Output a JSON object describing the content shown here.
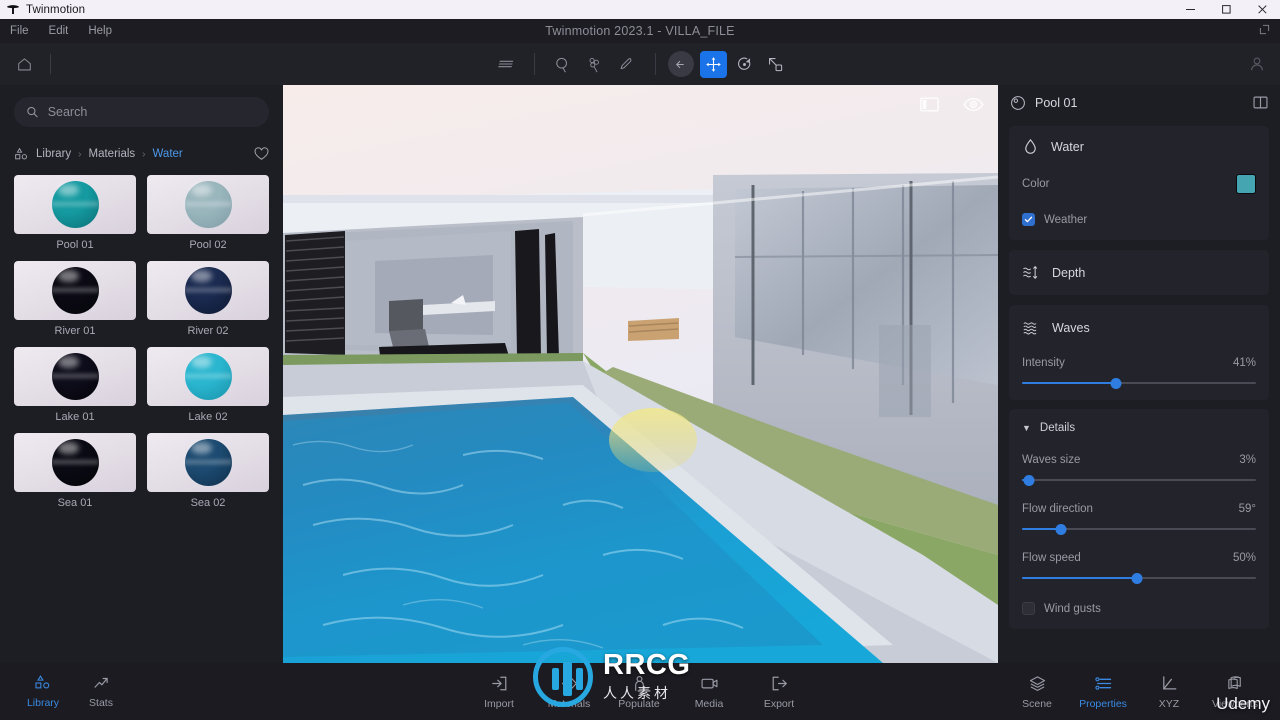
{
  "window": {
    "app_name": "Twinmotion",
    "document_title": "Twinmotion 2023.1 - VILLA_FILE",
    "controls": {
      "minimize": "–",
      "maximize": "❐",
      "close": "✕"
    }
  },
  "menu": {
    "items": [
      {
        "label": "File",
        "name": "menu-file"
      },
      {
        "label": "Edit",
        "name": "menu-edit"
      },
      {
        "label": "Help",
        "name": "menu-help"
      }
    ]
  },
  "toolbar": {
    "home_icon": "home-icon",
    "layers_icon": "layers-stack-icon",
    "tools": [
      {
        "name": "select-object-icon",
        "label": "Select object"
      },
      {
        "name": "select-material-icon",
        "label": "Select material"
      },
      {
        "name": "eyedropper-icon",
        "label": "Pick material"
      }
    ],
    "gizmos": [
      {
        "name": "undo-back-icon",
        "label": "Back",
        "active": false
      },
      {
        "name": "move-gizmo-icon",
        "label": "Move",
        "active": true
      },
      {
        "name": "rotate-gizmo-icon",
        "label": "Rotate",
        "active": false
      },
      {
        "name": "scale-gizmo-icon",
        "label": "Scale",
        "active": false
      }
    ],
    "account_icon": "user-account-icon",
    "active_accent": "#1a73e8"
  },
  "library": {
    "search": {
      "placeholder": "Search",
      "value": "",
      "icon": "search-icon"
    },
    "breadcrumb": {
      "root_icon": "library-shapes-icon",
      "items": [
        "Library",
        "Materials",
        "Water"
      ],
      "separator": "›",
      "favorite_icon": "heart-icon"
    },
    "materials": [
      {
        "label": "Pool 01",
        "color": "#149aa0",
        "shade": "#0b6f76",
        "selected": true
      },
      {
        "label": "Pool 02",
        "color": "#9ab6bd",
        "shade": "#7f9ba4",
        "selected": false
      },
      {
        "label": "River 01",
        "color": "#0b0a14",
        "shade": "#05050a",
        "selected": false
      },
      {
        "label": "River 02",
        "color": "#1a2a50",
        "shade": "#0d1830",
        "selected": false
      },
      {
        "label": "Lake 01",
        "color": "#0d0c1a",
        "shade": "#050409",
        "selected": false
      },
      {
        "label": "Lake 02",
        "color": "#2ab6cf",
        "shade": "#1991aa",
        "selected": false
      },
      {
        "label": "Sea 01",
        "color": "#0a0a14",
        "shade": "#040408",
        "selected": false
      },
      {
        "label": "Sea 02",
        "color": "#1c4a70",
        "shade": "#0f2f4c",
        "selected": false
      }
    ]
  },
  "viewport": {
    "overlay_icons": [
      {
        "name": "panel-layout-icon",
        "label": "Toggle panels"
      },
      {
        "name": "eye-visibility-icon",
        "label": "Toggle visibility"
      }
    ],
    "scene_description": "Villa exterior with swimming pool"
  },
  "properties": {
    "header": {
      "icon": "material-sphere-icon",
      "title": "Pool 01",
      "split_icon": "split-panel-icon"
    },
    "water": {
      "icon": "water-drop-icon",
      "title": "Water",
      "color_label": "Color",
      "color_value": "#45a6b2",
      "weather_label": "Weather",
      "weather_checked": true
    },
    "depth": {
      "icon": "depth-waves-icon",
      "title": "Depth"
    },
    "waves": {
      "icon": "waves-icon",
      "title": "Waves",
      "intensity": {
        "label": "Intensity",
        "value": "41%",
        "percent": 41
      },
      "details": {
        "caret": "▼",
        "title": "Details",
        "sliders": [
          {
            "label": "Waves size",
            "value": "3%",
            "percent": 3
          },
          {
            "label": "Flow direction",
            "value": "59°",
            "percent": 17
          },
          {
            "label": "Flow speed",
            "value": "50%",
            "percent": 50
          }
        ],
        "wind_gusts": {
          "label": "Wind gusts",
          "checked": false
        }
      }
    }
  },
  "bottom_bar": {
    "left": [
      {
        "label": "Library",
        "icon": "library-shapes-icon",
        "active": true
      },
      {
        "label": "Stats",
        "icon": "stats-arrow-icon",
        "active": false
      }
    ],
    "center": [
      {
        "label": "Import",
        "icon": "import-arrow-icon",
        "active": false
      },
      {
        "label": "Materials",
        "icon": "materials-diamond-icon",
        "active": false
      },
      {
        "label": "Populate",
        "icon": "populate-person-icon",
        "active": false
      },
      {
        "label": "Media",
        "icon": "media-camera-icon",
        "active": false
      },
      {
        "label": "Export",
        "icon": "export-arrow-icon",
        "active": false
      }
    ],
    "right": [
      {
        "label": "Scene",
        "icon": "scene-layers-icon",
        "active": false
      },
      {
        "label": "Properties",
        "icon": "properties-sliders-icon",
        "active": true
      },
      {
        "label": "XYZ",
        "icon": "axis-xyz-icon",
        "active": false
      },
      {
        "label": "Viewports",
        "icon": "viewports-icon",
        "active": false
      }
    ]
  },
  "watermark": {
    "brand": "RRCG",
    "subtitle": "人人素材",
    "corner": "Udemy"
  }
}
